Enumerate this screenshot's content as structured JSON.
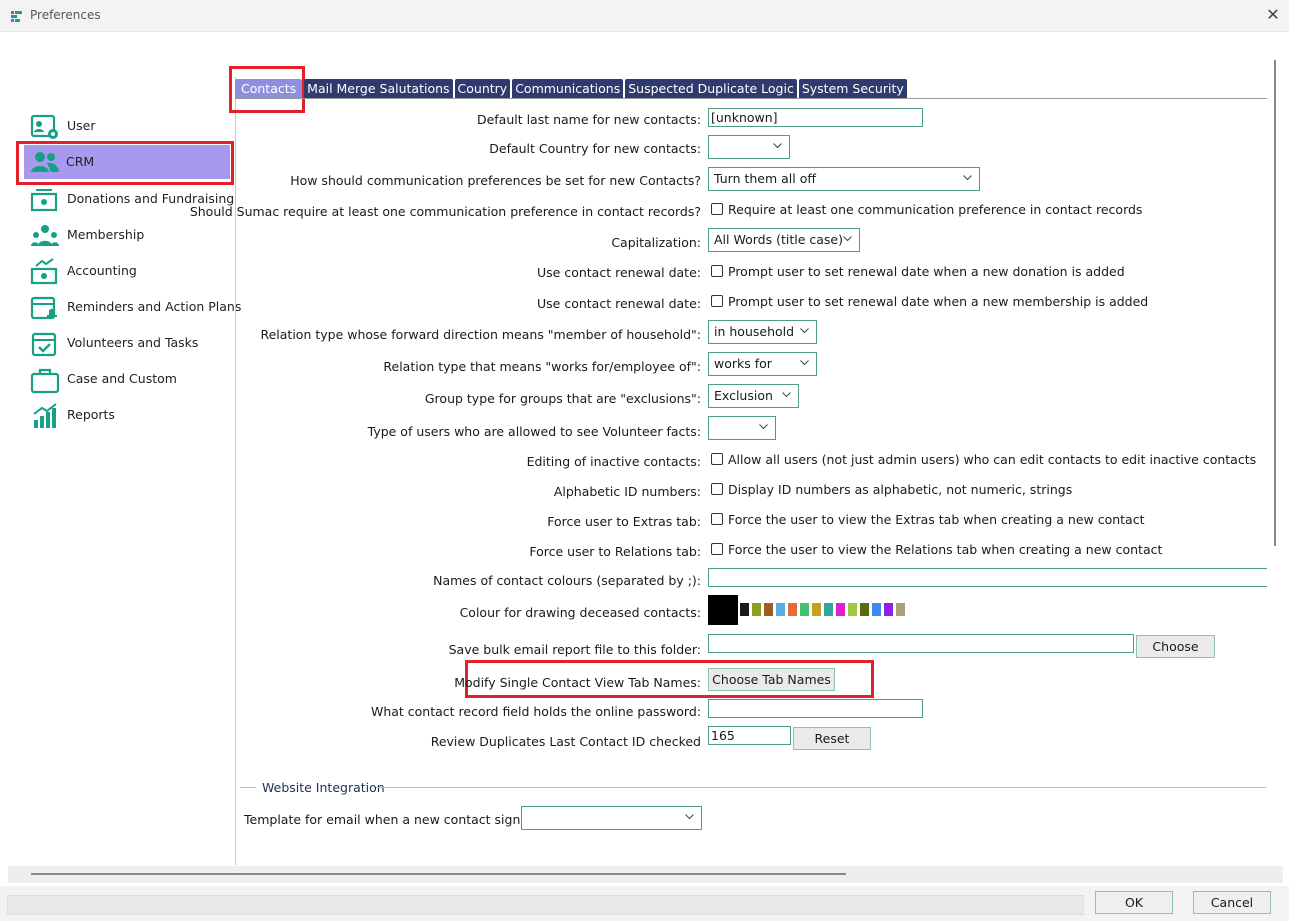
{
  "window": {
    "title": "Preferences",
    "close_glyph": "✕"
  },
  "sidebar": {
    "items": [
      {
        "label": "User",
        "icon": "user-card-icon"
      },
      {
        "label": "CRM",
        "icon": "people-icon"
      },
      {
        "label": "Donations and Fundraising",
        "icon": "donation-icon"
      },
      {
        "label": "Membership",
        "icon": "membership-icon"
      },
      {
        "label": "Accounting",
        "icon": "accounting-icon"
      },
      {
        "label": "Reminders and Action Plans",
        "icon": "reminder-icon"
      },
      {
        "label": "Volunteers and Tasks",
        "icon": "calendar-check-icon"
      },
      {
        "label": "Case and Custom",
        "icon": "briefcase-icon"
      },
      {
        "label": "Reports",
        "icon": "bar-chart-icon"
      }
    ],
    "selected": "CRM"
  },
  "tabs": [
    "Contacts",
    "Mail Merge Salutations",
    "Country",
    "Communications",
    "Suspected Duplicate Logic",
    "System Security"
  ],
  "active_tab": "Contacts",
  "form": {
    "default_last_name": {
      "label": "Default last name for new contacts:",
      "value": "[unknown]"
    },
    "default_country": {
      "label": "Default Country for new contacts:",
      "value": ""
    },
    "comm_prefs": {
      "label": "How should communication preferences be set for new Contacts?",
      "value": "Turn them all off"
    },
    "require_comm": {
      "label": "Should Sumac require at least one communication preference in contact records?",
      "check": "Require at least one communication preference in contact records",
      "checked": false
    },
    "capitalization": {
      "label": "Capitalization:",
      "value": "All Words (title case)"
    },
    "renewal_donation": {
      "label": "Use contact renewal date:",
      "check": "Prompt user to set renewal date when a new donation is added",
      "checked": false
    },
    "renewal_membership": {
      "label": "Use contact renewal date:",
      "check": "Prompt user to set renewal date when a new membership is added",
      "checked": false
    },
    "household_relation": {
      "label": "Relation type whose forward direction means \"member of household\":",
      "value": "in household"
    },
    "works_for_relation": {
      "label": "Relation type that means \"works for/employee of\":",
      "value": "works for"
    },
    "exclusion_group": {
      "label": "Group type for groups that are \"exclusions\":",
      "value": "Exclusion"
    },
    "volunteer_users": {
      "label": "Type of users who are allowed to see Volunteer facts:",
      "value": ""
    },
    "inactive_editing": {
      "label": "Editing of inactive contacts:",
      "check": "Allow all users (not just admin users) who can edit contacts to edit inactive contacts",
      "checked": false
    },
    "alpha_ids": {
      "label": "Alphabetic ID numbers:",
      "check": "Display ID numbers as alphabetic, not numeric, strings",
      "checked": false
    },
    "force_extras": {
      "label": "Force user to Extras tab:",
      "check": "Force the user to view the Extras tab when creating a new contact",
      "checked": false
    },
    "force_relations": {
      "label": "Force user to Relations tab:",
      "check": "Force the user to view the Relations tab when creating a new contact",
      "checked": false
    },
    "contact_colours": {
      "label": "Names of contact colours (separated by ;):",
      "value": ""
    },
    "deceased_colour": {
      "label": "Colour for drawing deceased contacts:",
      "selected": "#000000"
    },
    "bulk_email_folder": {
      "label": "Save bulk email report file to this folder:",
      "value": "",
      "button": "Choose"
    },
    "tab_names": {
      "label": "Modify Single Contact View Tab Names:",
      "button": "Choose Tab Names"
    },
    "online_password": {
      "label": "What contact record field holds the online password:",
      "value": ""
    },
    "review_duplicates": {
      "label": "Review Duplicates Last Contact ID checked",
      "value": "165",
      "button": "Reset"
    }
  },
  "palette": [
    "#1a1a1a",
    "#8aa020",
    "#a05c20",
    "#5aaee8",
    "#e86a38",
    "#40c070",
    "#c8a020",
    "#30a8a0",
    "#e020d0",
    "#a0c840",
    "#5a6a10",
    "#3a8af0",
    "#9020e8",
    "#a8a078"
  ],
  "website_integration": {
    "section_title": "Website Integration",
    "signup_template": {
      "label": "Template for email when a new contact signs up",
      "value": ""
    }
  },
  "dialog": {
    "ok": "OK",
    "cancel": "Cancel"
  },
  "colors": {
    "accent_tab": "#2f3b6e",
    "active_tab": "#8f8fe0",
    "selected_sidebar": "#a699ee",
    "field_border": "#4e9b86",
    "icon_teal": "#16a085",
    "highlight": "#e2202a"
  }
}
